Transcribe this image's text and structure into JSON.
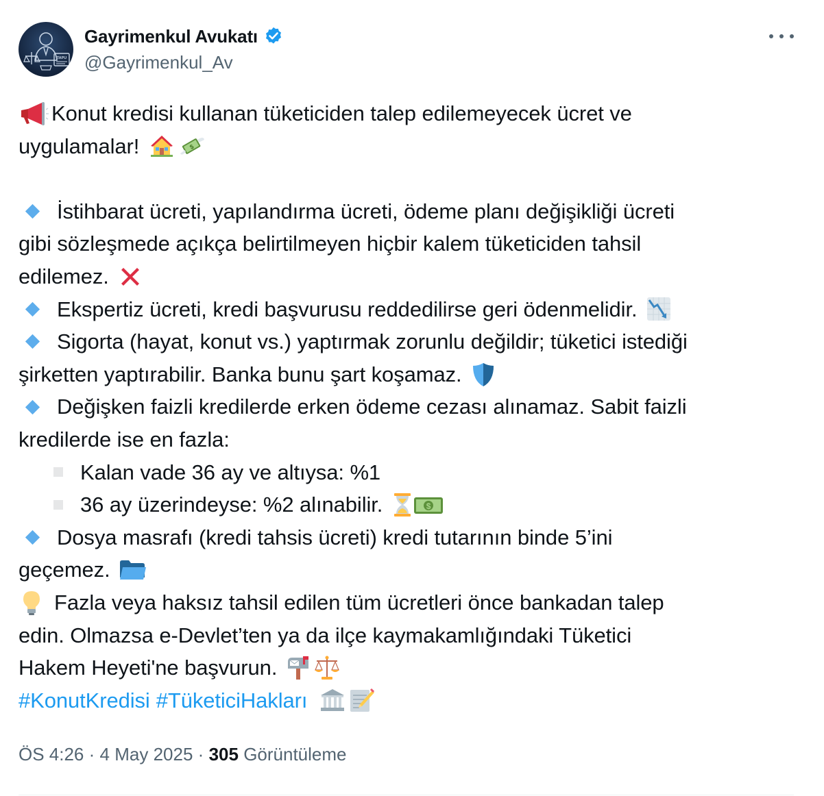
{
  "author": {
    "display_name": "Gayrimenkul Avukatı",
    "handle": "@Gayrimenkul_Av",
    "avatar_badge_text": "TAPU"
  },
  "tweet": {
    "intro_line1": "Konut kredisi kullanan tüketiciden talep edilemeyecek ücret ve",
    "intro_line2": "uygulamalar!",
    "b1_l1": "İstihbarat ücreti, yapılandırma ücreti, ödeme planı değişikliği ücreti",
    "b1_l2": "gibi sözleşmede açıkça belirtilmeyen hiçbir kalem tüketiciden tahsil",
    "b1_l3": "edilemez.",
    "b2_l1": "Ekspertiz ücreti, kredi başvurusu reddedilirse geri ödenmelidir.",
    "b3_l1": "Sigorta (hayat, konut vs.) yaptırmak zorunlu değildir; tüketici istediği",
    "b3_l2": "şirketten yaptırabilir. Banka bunu şart koşamaz.",
    "b4_l1": "Değişken faizli kredilerde erken ödeme cezası alınamaz. Sabit faizli",
    "b4_l2": "kredilerde ise en fazla:",
    "sub1": "Kalan vade 36 ay ve altıysa: %1",
    "sub2": "36 ay üzerindeyse: %2 alınabilir.",
    "b5_l1": "Dosya masrafı (kredi tahsis ücreti) kredi tutarının binde 5’ini",
    "b5_l2": "geçemez.",
    "tip_l1": "Fazla veya haksız tahsil edilen tüm ücretleri önce bankadan talep",
    "tip_l2": "edin. Olmazsa e-Devlet’ten ya da ilçe kaymakamlığındaki Tüketici",
    "tip_l3": "Hakem Heyeti'ne başvurun.",
    "hashtags": [
      "#KonutKredisi",
      "#TüketiciHakları"
    ],
    "bill_amount_glyph": "$"
  },
  "meta": {
    "time": "ÖS 4:26",
    "separator": "·",
    "date": "4 May 2025",
    "views_count": "305",
    "views_label": "Görüntüleme"
  },
  "icons": {
    "megaphone": "megaphone-icon",
    "house": "house-icon",
    "money_wings": "money-with-wings-icon",
    "cross": "cross-mark-icon",
    "chart_down": "chart-decreasing-icon",
    "shield": "shield-icon",
    "hourglass": "hourglass-icon",
    "banknote": "dollar-banknote-icon",
    "folder": "open-folder-icon",
    "bulb": "light-bulb-icon",
    "mailbox": "mailbox-icon",
    "scales": "balance-scale-icon",
    "bank": "bank-building-icon",
    "memo": "memo-icon"
  },
  "colors": {
    "link": "#1d9bf0",
    "verified": "#1d9bf0",
    "muted": "#536471",
    "text": "#0f1419",
    "bullet_diamond": "#5dadec"
  }
}
